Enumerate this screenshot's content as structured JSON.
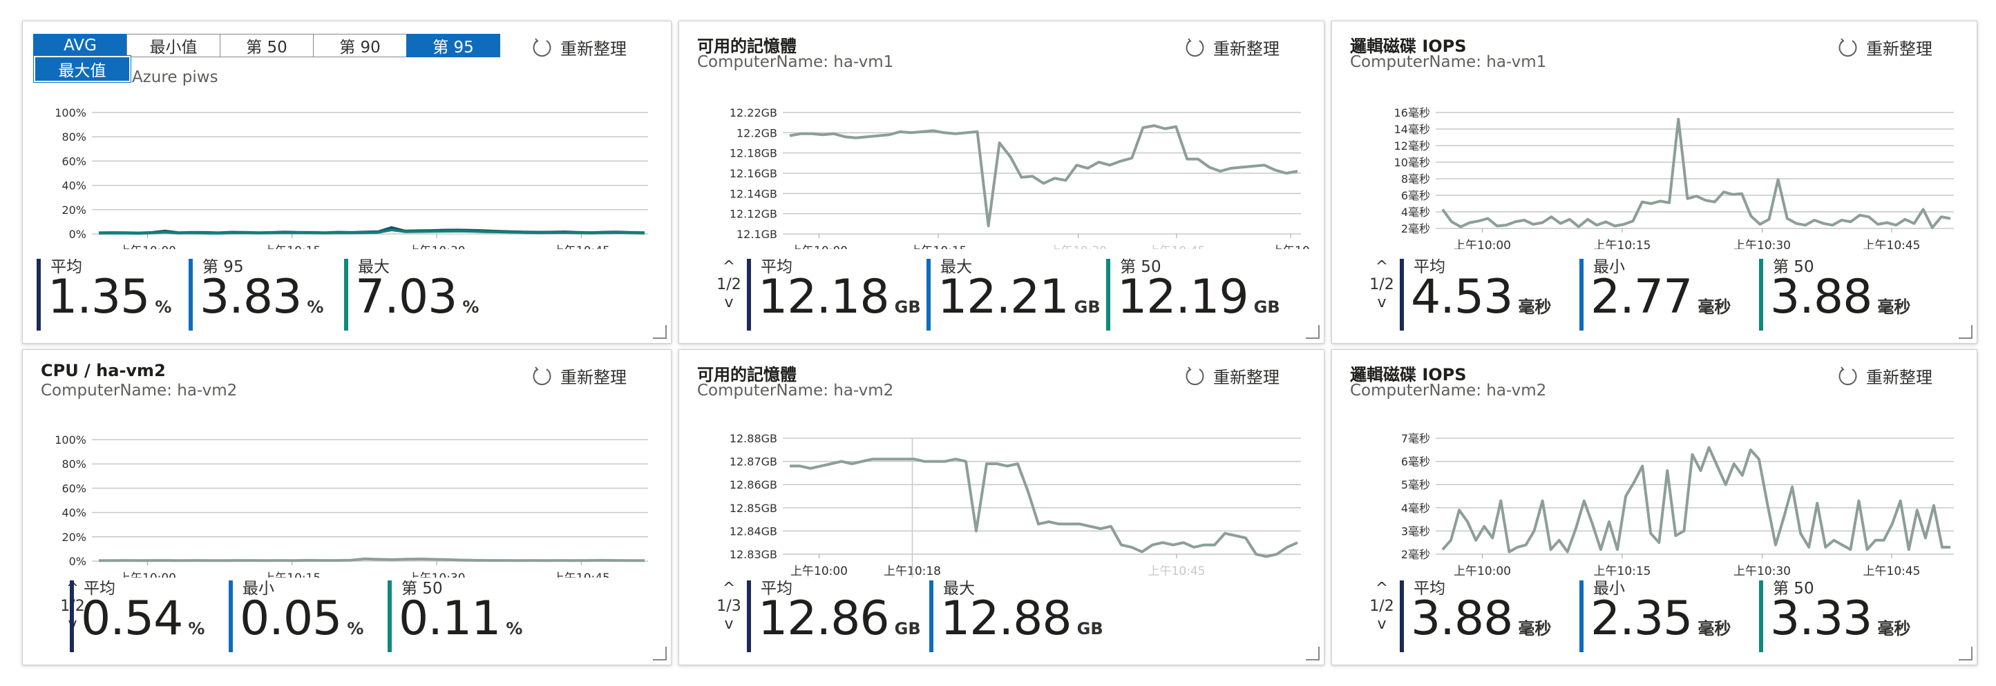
{
  "colors": {
    "avg": "#1b2a59",
    "mid": "#0f6cbd",
    "green": "#0e8a7c",
    "line": "#8c9f97",
    "cpu1": "#1b4a6b",
    "cpu2": "#10807a",
    "grid": "#c8c8c8"
  },
  "refresh_label": "重新整理",
  "aggregation": {
    "options": [
      "AVG",
      "最小值",
      "第 50",
      "第 90",
      "第 95"
    ],
    "selected": [
      "AVG",
      "第 95"
    ],
    "dropdown_item": "最大值",
    "peek_text": "Azure piws"
  },
  "tiles": [
    {
      "title": "",
      "subtitle": "",
      "chart_data": {
        "type": "line",
        "y_ticks": [
          "100%",
          "80%",
          "60%",
          "40%",
          "20%",
          "0%"
        ],
        "x_ticks": [
          "上午10:00",
          "上午10:15",
          "上午10:30",
          "上午10:45"
        ],
        "series": [
          {
            "color_key": "cpu1",
            "values": [
              0.9,
              1.1,
              1.0,
              0.8,
              1.2,
              2.4,
              1.0,
              1.3,
              1.2,
              0.9,
              1.4,
              1.3,
              1.0,
              1.2,
              1.6,
              1.3,
              1.2,
              1.0,
              1.4,
              1.2,
              1.6,
              1.8,
              5.2,
              2.4,
              2.6,
              2.8,
              3.1,
              3.2,
              3.0,
              2.6,
              2.2,
              1.8,
              1.6,
              1.4,
              1.5,
              1.7,
              1.3,
              1.1,
              1.4,
              1.6,
              1.2,
              1.0
            ]
          },
          {
            "color_key": "cpu2",
            "values": [
              0.6,
              0.8,
              0.7,
              0.5,
              0.9,
              1.5,
              0.8,
              0.9,
              0.7,
              0.6,
              0.9,
              1.0,
              0.8,
              0.9,
              1.1,
              1.0,
              0.9,
              0.8,
              1.0,
              0.9,
              1.1,
              1.3,
              3.4,
              1.9,
              2.0,
              2.1,
              2.3,
              2.4,
              2.2,
              1.9,
              1.7,
              1.4,
              1.2,
              1.0,
              1.1,
              1.2,
              0.9,
              0.8,
              1.0,
              1.2,
              0.9,
              0.7
            ]
          }
        ]
      },
      "metrics": [
        {
          "label": "平均",
          "value": "1.35",
          "unit": "%",
          "color_key": "avg"
        },
        {
          "label": "第 95",
          "value": "3.83",
          "unit": "%",
          "color_key": "mid"
        },
        {
          "label": "最大",
          "value": "7.03",
          "unit": "%",
          "color_key": "green"
        }
      ]
    },
    {
      "title": "可用的記憶體",
      "subtitle": "ComputerName: ha-vm1",
      "chart_data": {
        "type": "line",
        "y_ticks": [
          "12.22GB",
          "12.2GB",
          "12.18GB",
          "12.16GB",
          "12.14GB",
          "12.12GB",
          "12.1GB"
        ],
        "x_ticks": [
          "上午10:00",
          "上午10:15",
          "上午10:30",
          "上午10:45",
          "上午10"
        ],
        "series": [
          {
            "color_key": "line",
            "values": [
              12.197,
              12.199,
              12.199,
              12.198,
              12.199,
              12.196,
              12.195,
              12.196,
              12.197,
              12.198,
              12.201,
              12.2,
              12.201,
              12.202,
              12.2,
              12.199,
              12.2,
              12.201,
              12.108,
              12.19,
              12.176,
              12.156,
              12.157,
              12.15,
              12.155,
              12.153,
              12.168,
              12.165,
              12.171,
              12.168,
              12.172,
              12.175,
              12.205,
              12.207,
              12.204,
              12.206,
              12.174,
              12.174,
              12.166,
              12.162,
              12.165,
              12.166,
              12.167,
              12.168,
              12.163,
              12.16,
              12.162
            ]
          }
        ]
      },
      "pager": "1/2",
      "metrics": [
        {
          "label": "平均",
          "value": "12.18",
          "unit": "GB",
          "color_key": "avg"
        },
        {
          "label": "最大",
          "value": "12.21",
          "unit": "GB",
          "color_key": "mid"
        },
        {
          "label": "第 50",
          "value": "12.19",
          "unit": "GB",
          "color_key": "green"
        }
      ]
    },
    {
      "title": "邏輯磁碟 IOPS",
      "subtitle": "ComputerName: ha-vm1",
      "chart_data": {
        "type": "line",
        "y_ticks": [
          "16毫秒",
          "14毫秒",
          "12毫秒",
          "10毫秒",
          "8毫秒",
          "6毫秒",
          "4毫秒",
          "2毫秒"
        ],
        "x_ticks": [
          "上午10:00",
          "上午10:15",
          "上午10:30",
          "上午10:45"
        ],
        "series": [
          {
            "color_key": "line",
            "values": [
              4.3,
              2.8,
              2.2,
              2.7,
              2.9,
              3.2,
              2.3,
              2.4,
              2.8,
              3.0,
              2.5,
              2.7,
              3.4,
              2.6,
              3.1,
              2.2,
              3.1,
              2.4,
              2.8,
              2.3,
              2.5,
              2.9,
              5.2,
              5.0,
              5.3,
              5.1,
              15.2,
              5.6,
              5.9,
              5.4,
              5.2,
              6.4,
              6.1,
              6.2,
              3.5,
              2.5,
              3.1,
              7.9,
              3.2,
              2.6,
              2.4,
              3.0,
              2.6,
              2.4,
              3.0,
              2.8,
              3.6,
              3.4,
              2.5,
              2.7,
              2.4,
              3.1,
              2.6,
              4.3,
              2.1,
              3.4,
              3.2
            ]
          }
        ]
      },
      "pager": "1/2",
      "metrics": [
        {
          "label": "平均",
          "value": "4.53",
          "unit": "毫秒",
          "color_key": "avg"
        },
        {
          "label": "最小",
          "value": "2.77",
          "unit": "毫秒",
          "color_key": "mid"
        },
        {
          "label": "第 50",
          "value": "3.88",
          "unit": "毫秒",
          "color_key": "green"
        }
      ]
    },
    {
      "title": "CPU / ha-vm2",
      "subtitle": "ComputerName: ha-vm2",
      "chart_data": {
        "type": "line",
        "y_ticks": [
          "100%",
          "80%",
          "60%",
          "40%",
          "20%",
          "0%"
        ],
        "x_ticks": [
          "上午10:00",
          "上午10:15",
          "上午10:30",
          "上午10:45"
        ],
        "series": [
          {
            "color_key": "line",
            "values": [
              0.4,
              0.4,
              0.5,
              0.4,
              0.5,
              0.5,
              0.4,
              0.5,
              0.4,
              0.4,
              0.5,
              0.5,
              0.4,
              0.5,
              0.4,
              0.6,
              0.5,
              0.5,
              0.7,
              1.8,
              1.4,
              1.2,
              1.6,
              1.7,
              1.4,
              1.2,
              0.8,
              0.6,
              0.5,
              0.5,
              0.4,
              0.5,
              0.4,
              0.5,
              0.4,
              0.5,
              0.6,
              0.5,
              0.4,
              0.4
            ]
          }
        ]
      },
      "pager": "1/2",
      "metrics": [
        {
          "label": "平均",
          "value": "0.54",
          "unit": "%",
          "color_key": "avg"
        },
        {
          "label": "最小",
          "value": "0.05",
          "unit": "%",
          "color_key": "mid"
        },
        {
          "label": "第 50",
          "value": "0.11",
          "unit": "%",
          "color_key": "green"
        }
      ]
    },
    {
      "title": "可用的記憶體",
      "subtitle": "ComputerName: ha-vm2",
      "chart_data": {
        "type": "line",
        "y_ticks": [
          "12.88GB",
          "12.87GB",
          "12.86GB",
          "12.85GB",
          "12.84GB",
          "12.83GB"
        ],
        "x_ticks": [
          "上午10:00",
          "上午10:18",
          "上午10:45"
        ],
        "cursor_label": "上午10:18",
        "series": [
          {
            "color_key": "line",
            "values": [
              12.868,
              12.868,
              12.867,
              12.868,
              12.869,
              12.87,
              12.869,
              12.87,
              12.871,
              12.871,
              12.871,
              12.871,
              12.871,
              12.87,
              12.87,
              12.87,
              12.871,
              12.87,
              12.84,
              12.869,
              12.869,
              12.868,
              12.869,
              12.857,
              12.843,
              12.844,
              12.843,
              12.843,
              12.843,
              12.842,
              12.841,
              12.842,
              12.834,
              12.833,
              12.831,
              12.834,
              12.835,
              12.834,
              12.835,
              12.833,
              12.834,
              12.834,
              12.839,
              12.838,
              12.837,
              12.83,
              12.829,
              12.83,
              12.833,
              12.835
            ]
          }
        ]
      },
      "pager": "1/3",
      "metrics": [
        {
          "label": "平均",
          "value": "12.86",
          "unit": "GB",
          "color_key": "avg"
        },
        {
          "label": "最大",
          "value": "12.88",
          "unit": "GB",
          "color_key": "mid"
        }
      ]
    },
    {
      "title": "邏輯磁碟 IOPS",
      "subtitle": "ComputerName: ha-vm2",
      "chart_data": {
        "type": "line",
        "y_ticks": [
          "7毫秒",
          "6毫秒",
          "5毫秒",
          "4毫秒",
          "3毫秒",
          "2毫秒"
        ],
        "x_ticks": [
          "上午10:00",
          "上午10:15",
          "上午10:30",
          "上午10:45"
        ],
        "series": [
          {
            "color_key": "line",
            "values": [
              2.2,
              2.6,
              3.9,
              3.4,
              2.6,
              3.2,
              2.7,
              4.3,
              2.1,
              2.3,
              2.4,
              3.0,
              4.3,
              2.2,
              2.6,
              2.1,
              3.1,
              4.3,
              3.3,
              2.2,
              3.4,
              2.2,
              4.5,
              5.1,
              5.8,
              2.9,
              2.5,
              5.6,
              2.8,
              3.0,
              6.3,
              5.6,
              6.6,
              5.8,
              5.0,
              5.9,
              5.4,
              6.5,
              6.1,
              4.2,
              2.4,
              3.6,
              4.9,
              2.9,
              2.3,
              4.2,
              2.3,
              2.6,
              2.4,
              2.2,
              4.3,
              2.2,
              2.6,
              2.6,
              3.3,
              4.3,
              2.2,
              3.9,
              2.7,
              4.1,
              2.3,
              2.3
            ]
          }
        ]
      },
      "pager": "1/2",
      "metrics": [
        {
          "label": "平均",
          "value": "3.88",
          "unit": "毫秒",
          "color_key": "avg"
        },
        {
          "label": "最小",
          "value": "2.35",
          "unit": "毫秒",
          "color_key": "mid"
        },
        {
          "label": "第 50",
          "value": "3.33",
          "unit": "毫秒",
          "color_key": "green"
        }
      ]
    }
  ]
}
